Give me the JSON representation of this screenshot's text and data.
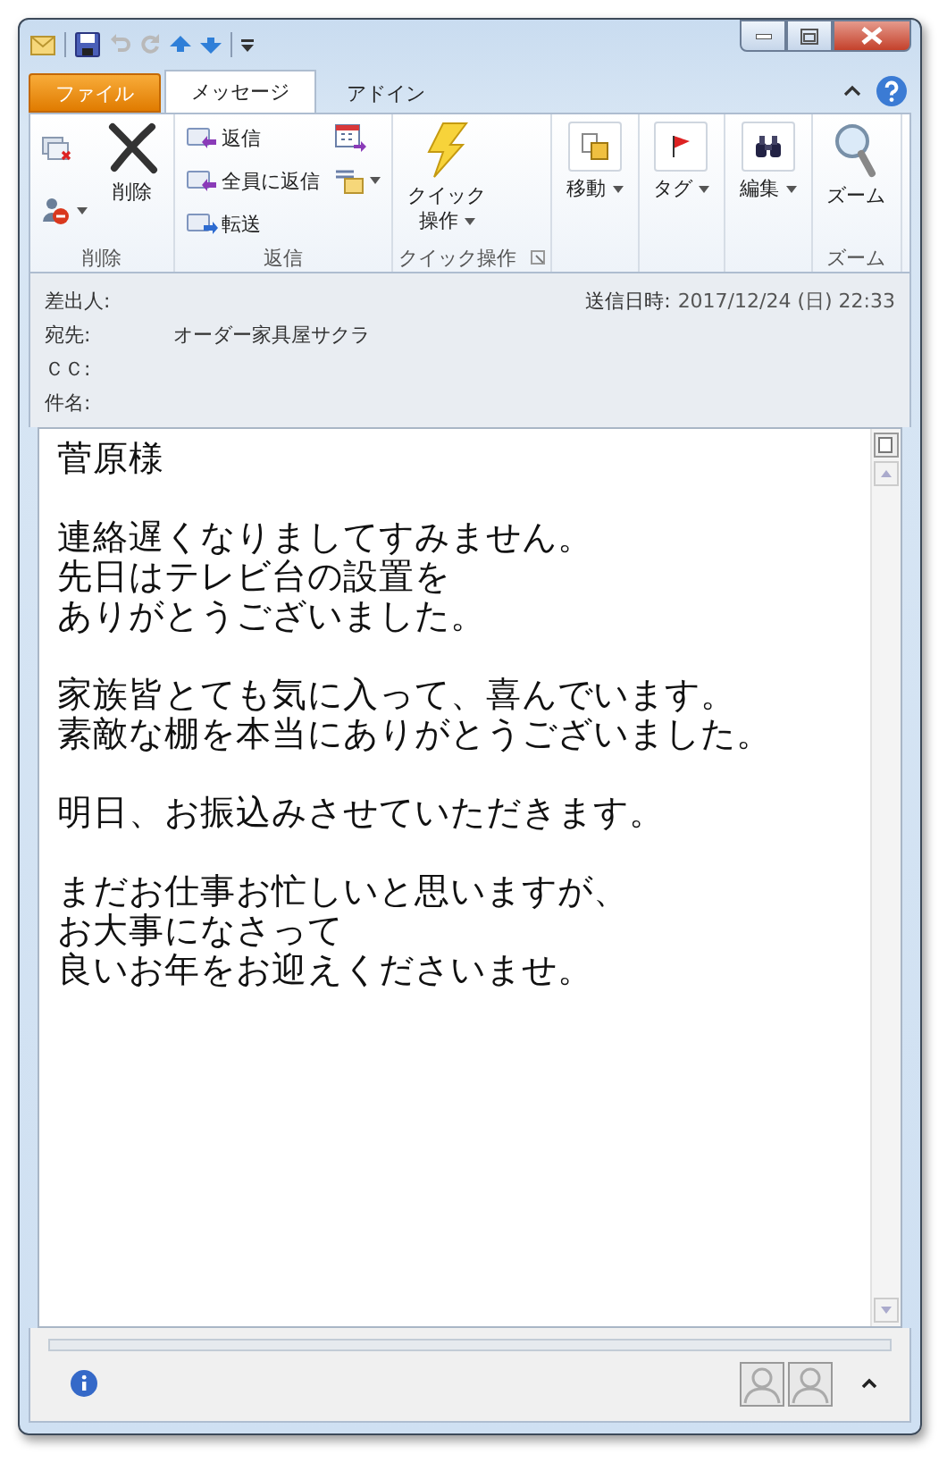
{
  "tabs": [
    {
      "label": "ファイル",
      "kind": "file",
      "selected": false
    },
    {
      "label": "メッセージ",
      "kind": "tab",
      "selected": true
    },
    {
      "label": "アドイン",
      "kind": "tab",
      "selected": false
    }
  ],
  "ribbon_groups": [
    {
      "label": "削除",
      "buttons": [
        {
          "kind": "icon"
        },
        {
          "kind": "icon",
          "dropdown": true
        },
        {
          "kind": "large",
          "lines": [
            "削除"
          ]
        }
      ]
    },
    {
      "label": "返信",
      "buttons": [
        {
          "kind": "small",
          "label": "返信"
        },
        {
          "kind": "small",
          "label": "全員に返信"
        },
        {
          "kind": "small",
          "label": "転送"
        },
        {
          "kind": "icon"
        },
        {
          "kind": "icon",
          "dropdown": true
        }
      ]
    },
    {
      "label": "クイック操作",
      "launcher": true,
      "buttons": [
        {
          "kind": "large",
          "lines": [
            "クイック",
            "操作"
          ],
          "dropdown": true
        }
      ]
    },
    {
      "buttons": [
        {
          "kind": "large",
          "lines": [
            "移動"
          ],
          "dropdown": true
        }
      ]
    },
    {
      "buttons": [
        {
          "kind": "large",
          "lines": [
            "タグ"
          ],
          "dropdown": true
        }
      ]
    },
    {
      "buttons": [
        {
          "kind": "large",
          "lines": [
            "編集"
          ],
          "dropdown": true
        }
      ]
    },
    {
      "label": "ズーム",
      "buttons": [
        {
          "kind": "large",
          "lines": [
            "ズーム"
          ]
        }
      ]
    }
  ],
  "header": {
    "fields": [
      {
        "label": "差出人:"
      },
      {
        "label": "宛先:",
        "value": "オーダー家具屋サクラ"
      },
      {
        "label": "ＣＣ:"
      },
      {
        "label": "件名:"
      }
    ],
    "sent": {
      "label": "送信日時:",
      "value": "2017/12/24 (日) 22:33"
    }
  },
  "body": [
    {
      "lines": [
        "菅原様"
      ]
    },
    {
      "lines": [
        "連絡遅くなりましてすみません。",
        "先日はテレビ台の設置を",
        "ありがとうございました。"
      ]
    },
    {
      "lines": [
        "家族皆とても気に入って、喜んでいます。",
        "素敵な棚を本当にありがとうございました。"
      ]
    },
    {
      "lines": [
        "明日、お振込みさせていただきます。"
      ]
    },
    {
      "lines": [
        "まだお仕事お忙しいと思いますが、",
        "お大事になさって",
        "良いお年をお迎えくださいませ。"
      ]
    }
  ]
}
